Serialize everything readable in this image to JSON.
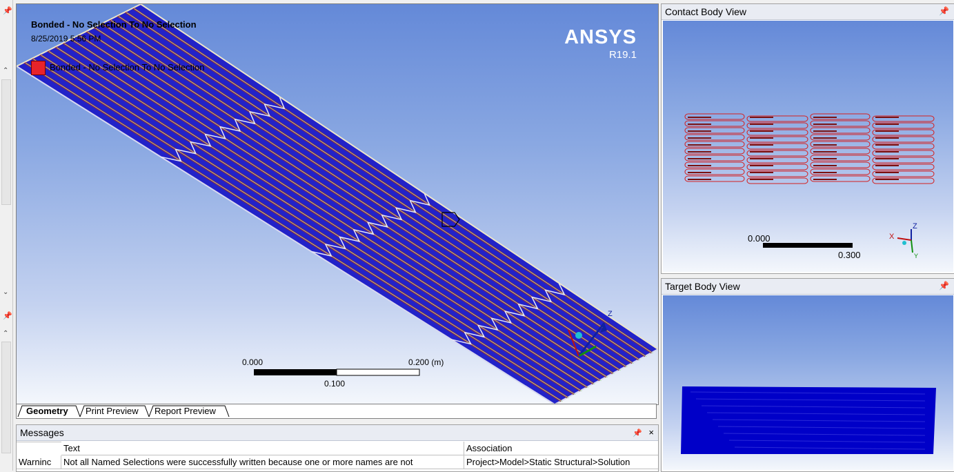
{
  "viewport": {
    "title": "Bonded - No Selection To No Selection",
    "date": "8/25/2019 5:56 PM",
    "legend_label": "Bonded - No Selection To No Selection",
    "legend_color": "#e8232a",
    "logo": "ANSYS",
    "version": "R19.1",
    "scale": {
      "left": "0.000",
      "right": "0.200 (m)",
      "mid": "0.100"
    },
    "axis_label": "Z",
    "body_color": "#2222c8"
  },
  "tabs": [
    {
      "label": "Geometry",
      "active": true
    },
    {
      "label": "Print Preview",
      "active": false
    },
    {
      "label": "Report Preview",
      "active": false
    }
  ],
  "messages": {
    "title": "Messages",
    "pin_icon": "📌",
    "close_icon": "×",
    "columns": [
      "",
      "Text",
      "Association"
    ],
    "rows": [
      {
        "type": "Warninc",
        "text": "Not all Named Selections were successfully written because one or more names are not",
        "association": "Project>Model>Static Structural>Solution"
      }
    ]
  },
  "contact_view": {
    "title": "Contact Body View",
    "scale": {
      "left": "0.000",
      "right": "0.300"
    },
    "axes": {
      "x": "X",
      "y": "Y",
      "z": "Z"
    },
    "mesh_color": "#d42020"
  },
  "target_view": {
    "title": "Target Body View",
    "body_color": "#0000c8"
  }
}
